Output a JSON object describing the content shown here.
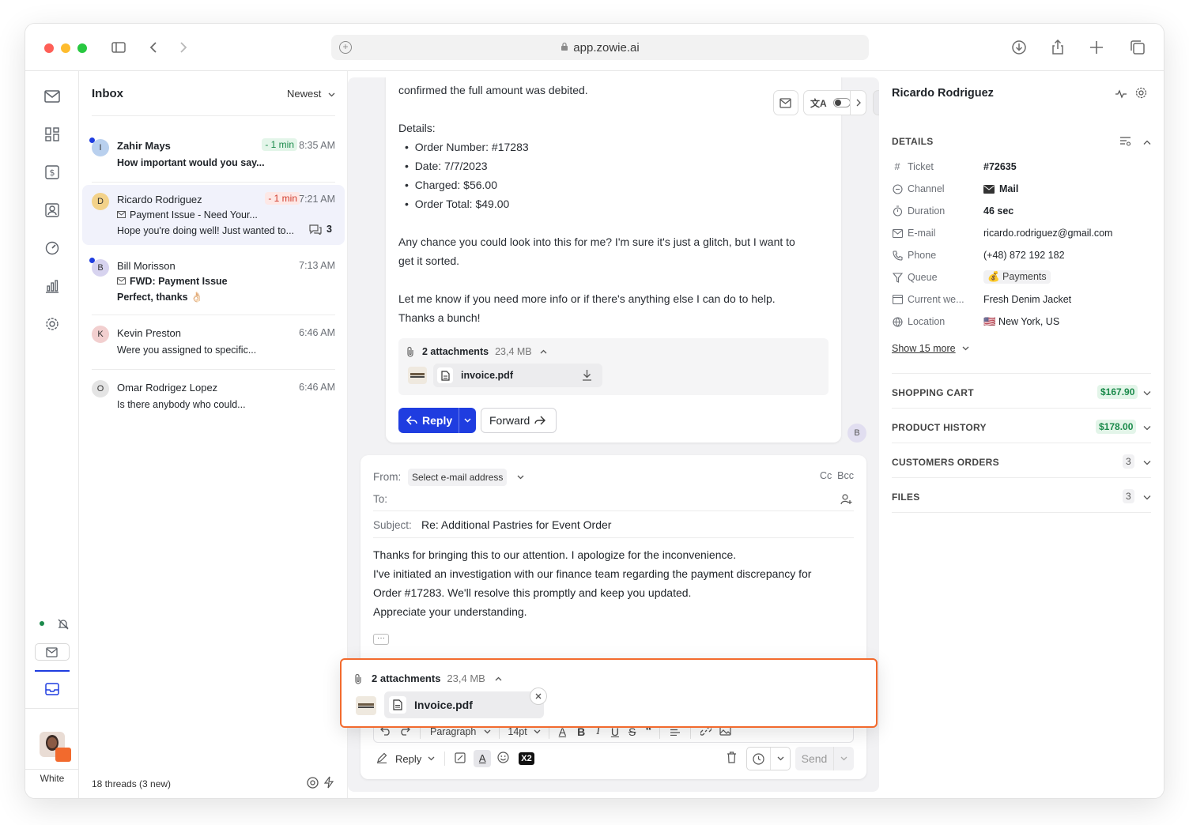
{
  "browser": {
    "url": "app.zowie.ai"
  },
  "rail": {
    "user_label": "White"
  },
  "inbox": {
    "title": "Inbox",
    "sort_label": "Newest",
    "threads": [
      {
        "initial": "I",
        "name": "Zahir Mays",
        "badge": "- 1 min",
        "time": "8:35 AM",
        "line1": "How important would you say...",
        "line2": "",
        "subject": ""
      },
      {
        "initial": "D",
        "name": "Ricardo Rodriguez",
        "badge": "- 1 min",
        "time": "7:21 AM",
        "subject": "Payment Issue - Need Your...",
        "line2": "Hope you're doing well! Just wanted to...",
        "count": "3"
      },
      {
        "initial": "B",
        "name": "Bill Morisson",
        "time": "7:13 AM",
        "subject": "FWD: Payment Issue",
        "line2": "Perfect, thanks 👌🏻"
      },
      {
        "initial": "K",
        "name": "Kevin Preston",
        "time": "6:46 AM",
        "line1": "Were you assigned to specific..."
      },
      {
        "initial": "O",
        "name": "Omar Rodrigez Lopez",
        "time": "6:46 AM",
        "line1": "Is there anybody who could..."
      }
    ],
    "footer": "18 threads (3 new)"
  },
  "message": {
    "para1": "confirmed the full amount was debited.",
    "details_label": "Details:",
    "bullets": [
      "Order Number: #17283",
      "Date: 7/7/2023",
      "Charged: $56.00",
      "Order Total: $49.00"
    ],
    "para2a": "Any chance you could look into this for me? I'm sure it's just a glitch, but I want to",
    "para2b": "get it sorted.",
    "para3a": "Let me know if you need more info or if there's anything else I can do to help.",
    "para3b": "Thanks a bunch!",
    "attachments_label": "2 attachments",
    "attachments_size": "23,4 MB",
    "file_name": "invoice.pdf",
    "reply_label": "Reply",
    "forward_label": "Forward",
    "sender_initial": "B"
  },
  "compose": {
    "from_label": "From:",
    "from_value": "Select e-mail address",
    "cc_bcc": "Cc  Bcc",
    "to_label": "To:",
    "subject_label": "Subject:",
    "subject_value": "Re: Additional Pastries for Event Order",
    "body": [
      "Thanks for bringing this to our attention. I apologize for the inconvenience.",
      "I've initiated an investigation with our finance team regarding the payment discrepancy for",
      "Order #17283. We'll resolve this promptly and keep you updated.",
      "Appreciate your understanding."
    ],
    "more": "···",
    "paragraph_label": "Paragraph",
    "font_size": "14pt",
    "reply_mode": "Reply",
    "x2_label": "X2",
    "send_label": "Send"
  },
  "attach_popup": {
    "label": "2 attachments",
    "size": "23,4 MB",
    "file_name": "Invoice.pdf"
  },
  "details": {
    "contact_name": "Ricardo Rodriguez",
    "section_details": "DETAILS",
    "rows": [
      {
        "key": "Ticket",
        "value": "#72635",
        "icon": "hash-icon"
      },
      {
        "key": "Channel",
        "value": "Mail",
        "icon": "chat-icon"
      },
      {
        "key": "Duration",
        "value": "46 sec",
        "icon": "stopwatch-icon"
      },
      {
        "key": "E-mail",
        "value": "ricardo.rodriguez@gmail.com",
        "icon": "mail-icon"
      },
      {
        "key": "Phone",
        "value": "(+48) 872 192 182",
        "icon": "phone-icon"
      },
      {
        "key": "Queue",
        "value": "💰 Payments",
        "icon": "filter-icon"
      },
      {
        "key": "Current we...",
        "value": "Fresh Denim Jacket",
        "icon": "browser-icon"
      },
      {
        "key": "Location",
        "value": "🇺🇸 New York, US",
        "icon": "globe-icon"
      }
    ],
    "show_more": "Show 15 more",
    "sections": [
      {
        "label": "SHOPPING CART",
        "badge": "$167.90",
        "color": "#1b8a4b"
      },
      {
        "label": "PRODUCT HISTORY",
        "badge": "$178.00",
        "color": "#1b8a4b"
      },
      {
        "label": "CUSTOMERS ORDERS",
        "badge": "3",
        "color": "#555555"
      },
      {
        "label": "FILES",
        "badge": "3",
        "color": "#555555"
      }
    ]
  },
  "colors": {
    "accent": "#1f3de0",
    "highlight_border": "#f26a2d",
    "green_badge_bg": "#e3f5e9",
    "red_badge_bg": "#fde8e6"
  }
}
